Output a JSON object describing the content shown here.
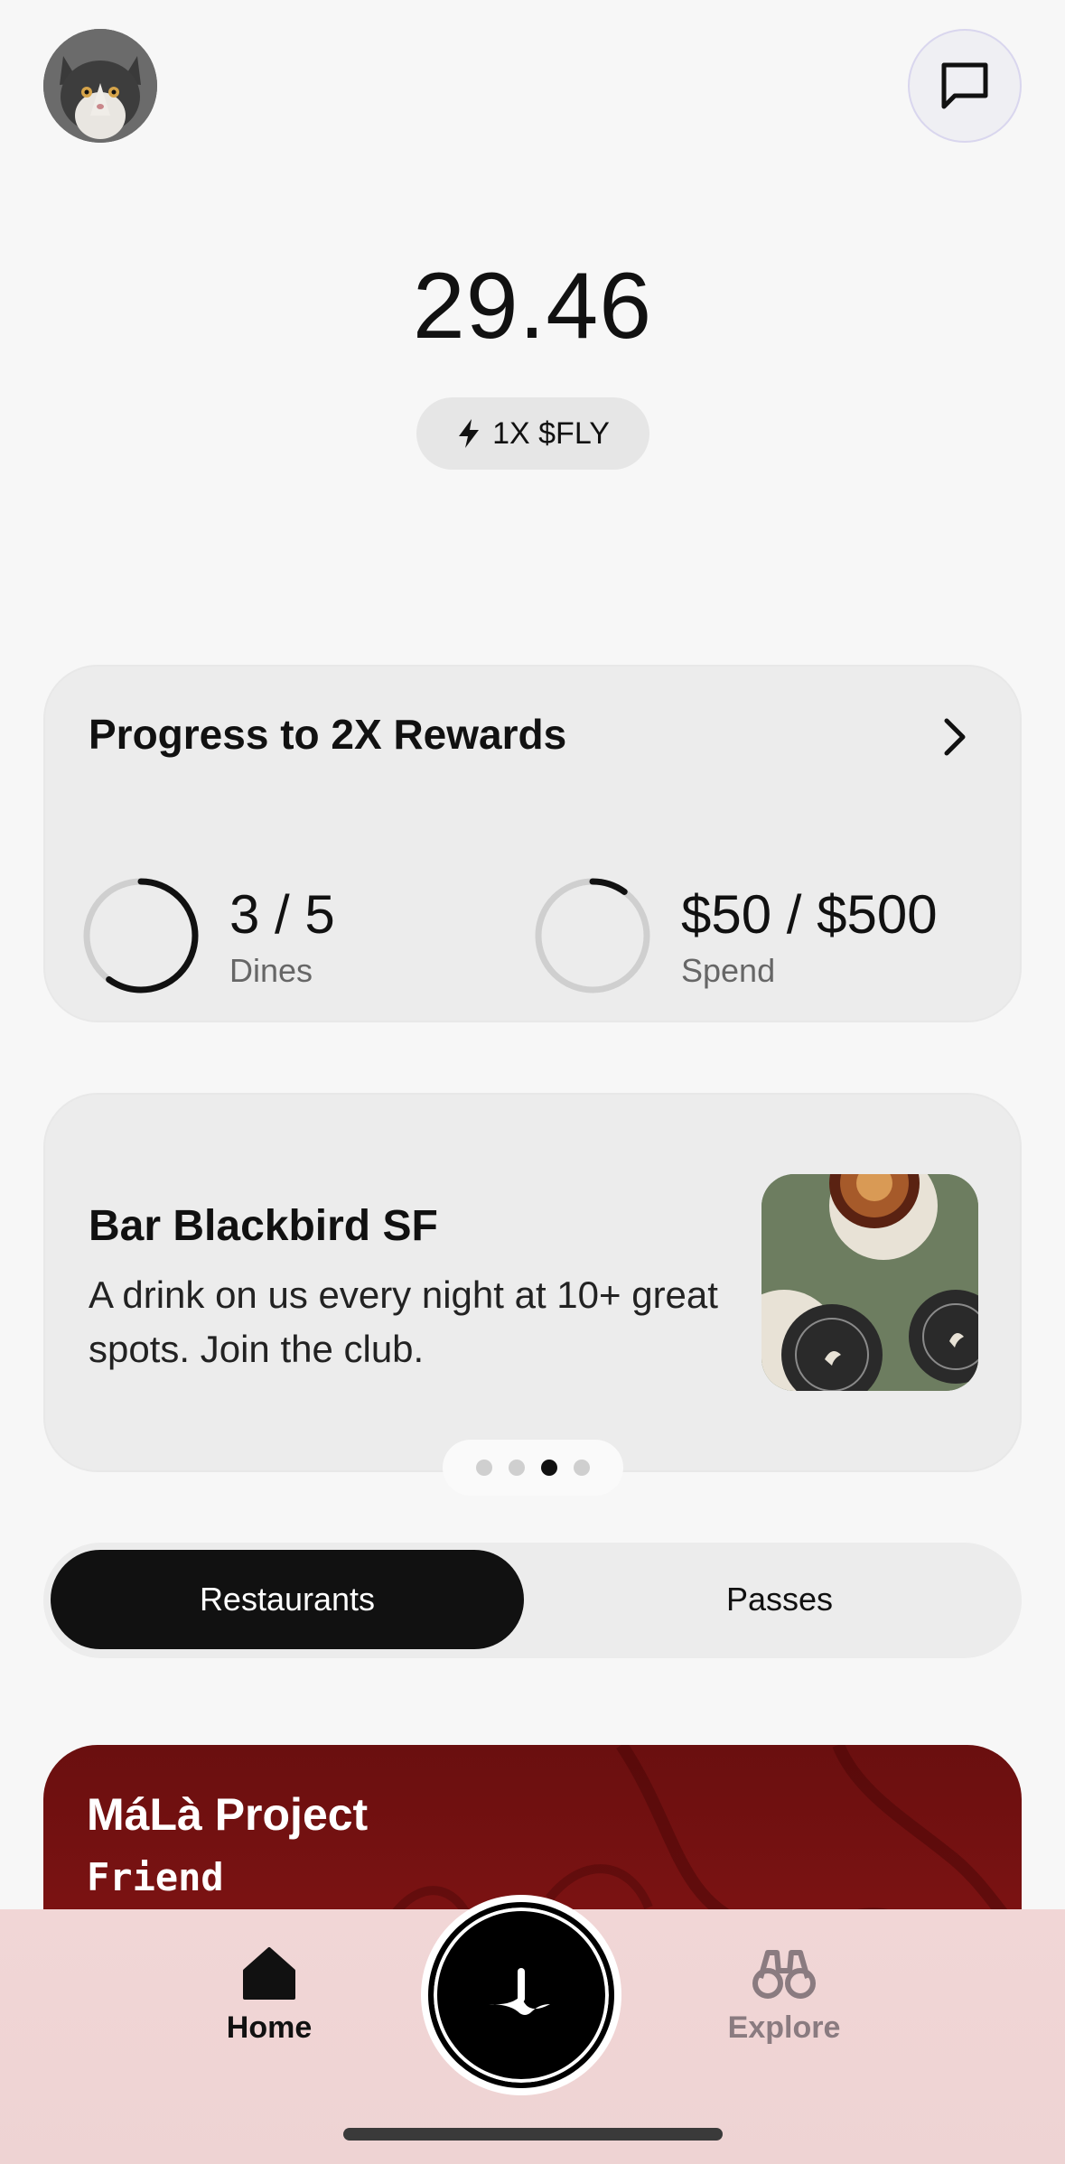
{
  "header": {
    "avatar_icon": "cat-avatar",
    "messages_icon": "chat-bubble-icon"
  },
  "balance": {
    "amount": "29.46",
    "multiplier_label": "1X $FLY",
    "multiplier_icon": "lightning-icon"
  },
  "progress": {
    "title": "Progress to 2X Rewards",
    "dines": {
      "value": "3 / 5",
      "label": "Dines",
      "fraction": 0.6
    },
    "spend": {
      "value": "$50 / $500",
      "label": "Spend",
      "fraction": 0.1
    }
  },
  "promo": {
    "title": "Bar Blackbird SF",
    "description": "A drink on us every night at 10+ great spots. Join the club.",
    "carousel": {
      "count": 4,
      "active_index": 2
    }
  },
  "tabs": {
    "restaurants_label": "Restaurants",
    "passes_label": "Passes",
    "active": "Restaurants"
  },
  "restaurant": {
    "name": "MáLà Project",
    "tier": "Friend"
  },
  "nav": {
    "home_label": "Home",
    "explore_label": "Explore"
  },
  "colors": {
    "accent_dark": "#111111",
    "restaurant_card": "#871515",
    "nav_background": "#f1d6d6"
  }
}
